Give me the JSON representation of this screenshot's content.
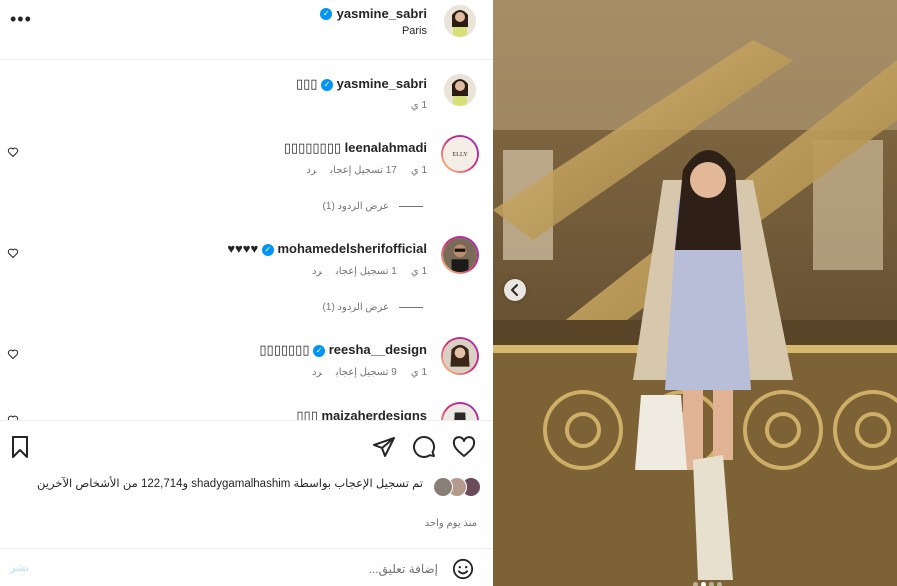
{
  "post_header": {
    "username": "yasmine_sabri",
    "location": "Paris",
    "more_label": "•••"
  },
  "caption": {
    "username": "yasmine_sabri",
    "text": "▯▯▯",
    "time": "1 ي"
  },
  "comments": [
    {
      "username": "leenalahmadi",
      "text": "▯▯▯▯▯▯▯▯",
      "verified": false,
      "time": "1 ي",
      "likes": "17 تسجيل إعجاب",
      "reply": "رد",
      "view_replies": "عرض الردود (1)"
    },
    {
      "username": "mohamedelsherifofficial",
      "text": "♥♥♥♥",
      "verified": true,
      "time": "1 ي",
      "likes": "1 تسجيل إعجاب",
      "reply": "رد",
      "view_replies": "عرض الردود (1)"
    },
    {
      "username": "reesha__design",
      "text": "▯▯▯▯▯▯▯",
      "verified": true,
      "time": "1 ي",
      "likes": "9 تسجيل إعجاب",
      "reply": "رد"
    },
    {
      "username": "maizaherdesigns",
      "text": "▯▯▯",
      "verified": false
    }
  ],
  "likes_summary": "تم تسجيل الإعجاب بواسطة shadygamalhashim و122,714 من الأشخاص الآخرين",
  "post_time": "منذ يوم واحد",
  "composer": {
    "placeholder": "إضافة تعليق...",
    "post_label": "نشر"
  },
  "icons": [
    "more-icon",
    "verified-icon",
    "heart-icon",
    "bookmark-icon",
    "share-icon",
    "comment-icon",
    "like-icon",
    "emoji-icon",
    "chevron-left-icon"
  ],
  "colors": {
    "verified": "#0095f6",
    "post_link": "#b2dffc",
    "muted_text": "#737373"
  },
  "carousel": {
    "slide_count": 4,
    "active_index": 1
  }
}
